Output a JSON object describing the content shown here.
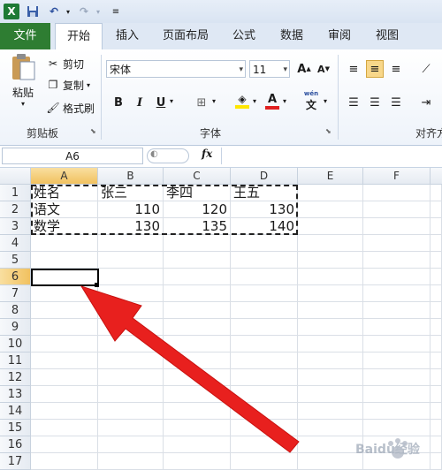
{
  "title_bar": {
    "app_icon": "excel-icon",
    "save_icon": "save-icon",
    "undo_icon": "undo-icon",
    "redo_icon": "redo-icon",
    "customize_icon": "customize-qat-icon"
  },
  "tabs": [
    {
      "label": "文件"
    },
    {
      "label": "开始"
    },
    {
      "label": "插入"
    },
    {
      "label": "页面布局"
    },
    {
      "label": "公式"
    },
    {
      "label": "数据"
    },
    {
      "label": "审阅"
    },
    {
      "label": "视图"
    }
  ],
  "ribbon": {
    "clipboard": {
      "paste": "粘贴",
      "cut": "剪切",
      "copy": "复制",
      "format_painter": "格式刷",
      "group_label": "剪贴板"
    },
    "font": {
      "font_name": "宋体",
      "font_size": "11",
      "group_label": "字体",
      "phonetic": "文"
    },
    "alignment": {
      "group_label": "对齐方"
    }
  },
  "formula_bar": {
    "name_box": "A6",
    "fx": "fx",
    "formula": ""
  },
  "sheet": {
    "columns": [
      "A",
      "B",
      "C",
      "D",
      "E",
      "F"
    ],
    "rows": [
      "1",
      "2",
      "3",
      "4",
      "5",
      "6",
      "7",
      "8",
      "9",
      "10",
      "11",
      "12",
      "13",
      "14",
      "15",
      "16",
      "17"
    ],
    "cells": {
      "A1": "姓名",
      "B1": "张三",
      "C1": "李四",
      "D1": "王五",
      "A2": "语文",
      "B2": "110",
      "C2": "120",
      "D2": "130",
      "A3": "数学",
      "B3": "130",
      "C3": "135",
      "D3": "140"
    },
    "selected_cell": "A6"
  },
  "colors": {
    "file_tab": "#2e7d32",
    "arrow": "#e8201e",
    "selection_header": "#f1c15f"
  },
  "watermark": "Baidu经验"
}
